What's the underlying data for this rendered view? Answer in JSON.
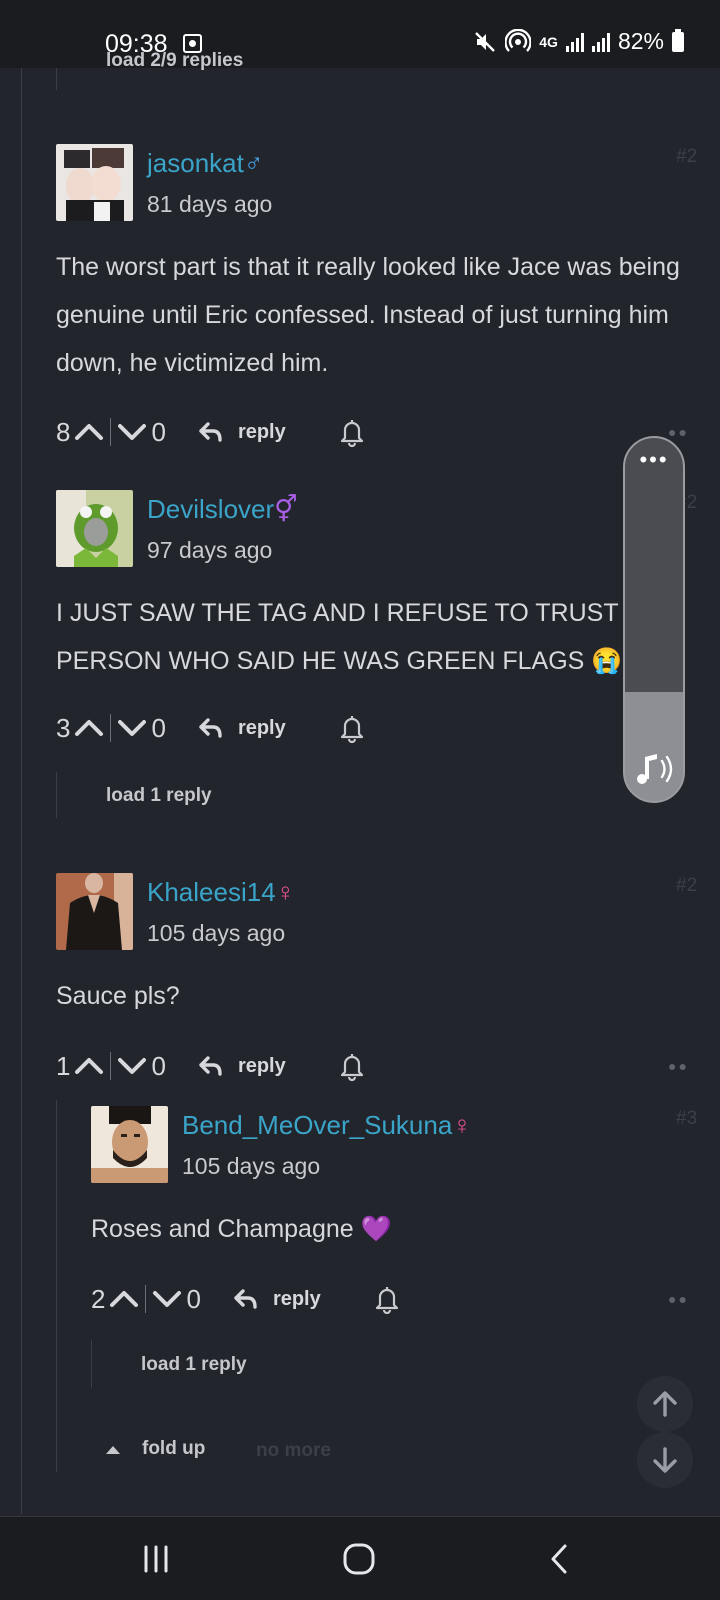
{
  "status_bar": {
    "time": "09:38",
    "network": "4G",
    "battery": "82%"
  },
  "thread": {
    "top_load_label": "load 2/9 replies",
    "reply_label": "reply",
    "load_one_reply": "load 1 reply",
    "fold_up_label": "fold up",
    "no_more_label": "no more"
  },
  "comments": [
    {
      "username": "jasonkat",
      "gender": "♂",
      "time_ago": "81 days ago",
      "index": "#2",
      "text": "The worst part is that it really looked like Jace was being genuine until Eric confessed. Instead of just turning him down, he victimized him.",
      "upvotes": "8",
      "downvotes": "0"
    },
    {
      "username": "Devilslover",
      "gender": "⚥",
      "time_ago": "97 days ago",
      "index": "#2",
      "text": "I JUST SAW THE TAG AND I REFUSE TO TRUST THE PERSON WHO SAID HE WAS GREEN FLAGS 😭",
      "upvotes": "3",
      "downvotes": "0"
    },
    {
      "username": "Khaleesi14",
      "gender": "♀",
      "time_ago": "105 days ago",
      "index": "#2",
      "text": "Sauce pls?",
      "upvotes": "1",
      "downvotes": "0"
    },
    {
      "username": "Bend_MeOver_Sukuna",
      "gender": "♀",
      "time_ago": "105 days ago",
      "index": "#3",
      "text": "Roses and Champagne 💜",
      "upvotes": "2",
      "downvotes": "0"
    }
  ],
  "colors": {
    "background": "#22252c",
    "username": "#3aa4c9",
    "male": "#4aa3e9",
    "female": "#e8518f",
    "nonbinary": "#a95fe4"
  }
}
